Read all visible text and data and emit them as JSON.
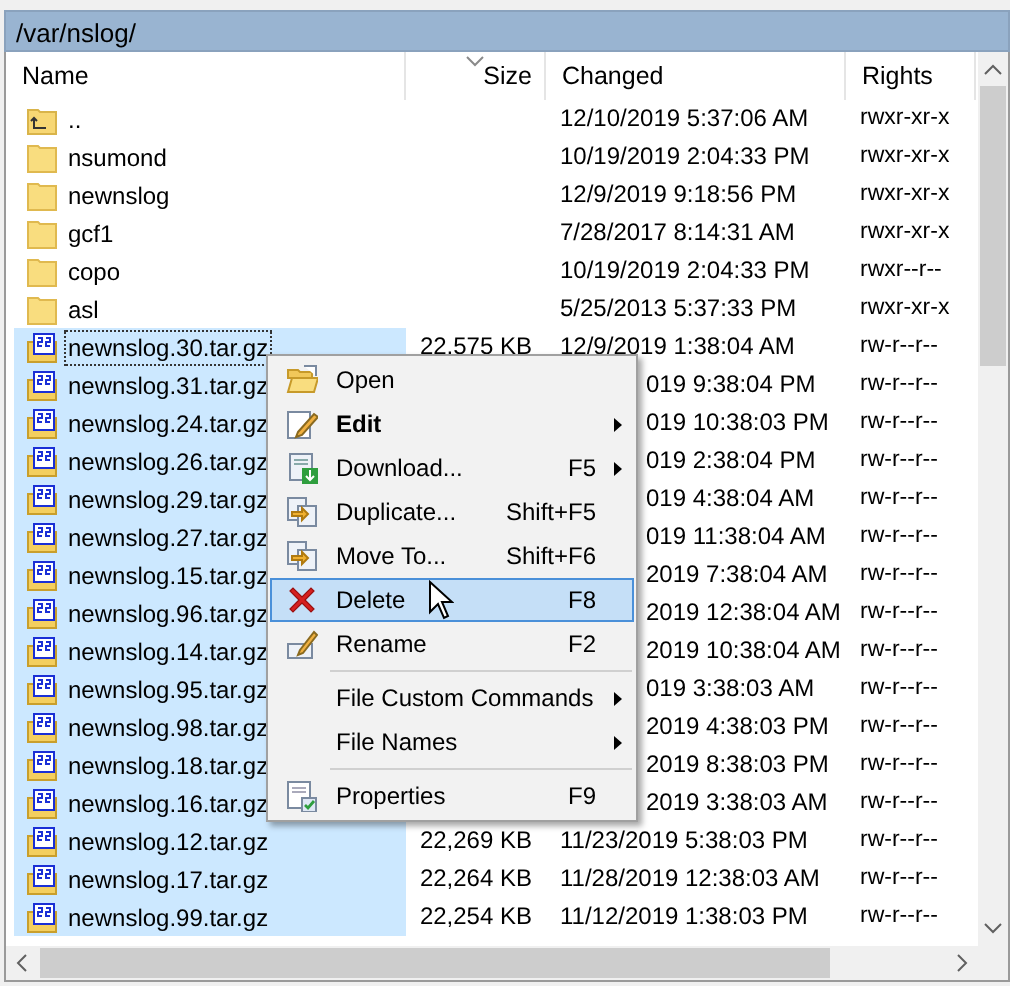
{
  "panel": {
    "path": "/var/nslog/"
  },
  "columns": [
    {
      "label": "Name",
      "sorted": false
    },
    {
      "label": "Size",
      "sorted": true
    },
    {
      "label": "Changed",
      "sorted": false
    },
    {
      "label": "Rights",
      "sorted": false
    }
  ],
  "rows": [
    {
      "kind": "parent",
      "name": "..",
      "changed": "12/10/2019 5:37:06 AM",
      "rights": "rwxr-xr-x",
      "selected": false,
      "focused": false
    },
    {
      "kind": "folder",
      "name": "nsumond",
      "changed": "10/19/2019 2:04:33 PM",
      "rights": "rwxr-xr-x",
      "selected": false,
      "focused": false
    },
    {
      "kind": "folder",
      "name": "newnslog",
      "changed": "12/9/2019 9:18:56 PM",
      "rights": "rwxr-xr-x",
      "selected": false,
      "focused": false
    },
    {
      "kind": "folder",
      "name": "gcf1",
      "changed": "7/28/2017 8:14:31 AM",
      "rights": "rwxr-xr-x",
      "selected": false,
      "focused": false
    },
    {
      "kind": "folder",
      "name": "copo",
      "changed": "10/19/2019 2:04:33 PM",
      "rights": "rwxr--r--",
      "selected": false,
      "focused": false
    },
    {
      "kind": "folder",
      "name": "asl",
      "changed": "5/25/2013 5:37:33 PM",
      "rights": "rwxr-xr-x",
      "selected": false,
      "focused": false
    },
    {
      "kind": "archive",
      "name": "newnslog.30.tar.gz",
      "size": "22,575 KB",
      "changed": "12/9/2019 1:38:04 AM",
      "rights": "rw-r--r--",
      "selected": true,
      "focused": true
    },
    {
      "kind": "archive",
      "name": "newnslog.31.tar.gz",
      "changed": "019 9:38:04 PM",
      "rights": "rw-r--r--",
      "selected": true,
      "focused": false
    },
    {
      "kind": "archive",
      "name": "newnslog.24.tar.gz",
      "changed": "019 10:38:03 PM",
      "rights": "rw-r--r--",
      "selected": true,
      "focused": false
    },
    {
      "kind": "archive",
      "name": "newnslog.26.tar.gz",
      "changed": "019 2:38:04 PM",
      "rights": "rw-r--r--",
      "selected": true,
      "focused": false
    },
    {
      "kind": "archive",
      "name": "newnslog.29.tar.gz",
      "changed": "019 4:38:04 AM",
      "rights": "rw-r--r--",
      "selected": true,
      "focused": false
    },
    {
      "kind": "archive",
      "name": "newnslog.27.tar.gz",
      "changed": "019 11:38:04 AM",
      "rights": "rw-r--r--",
      "selected": true,
      "focused": false
    },
    {
      "kind": "archive",
      "name": "newnslog.15.tar.gz",
      "changed": "2019 7:38:04 AM",
      "rights": "rw-r--r--",
      "selected": true,
      "focused": false
    },
    {
      "kind": "archive",
      "name": "newnslog.96.tar.gz",
      "changed": "2019 12:38:04 AM",
      "rights": "rw-r--r--",
      "selected": true,
      "focused": false
    },
    {
      "kind": "archive",
      "name": "newnslog.14.tar.gz",
      "changed": "2019 10:38:04 AM",
      "rights": "rw-r--r--",
      "selected": true,
      "focused": false
    },
    {
      "kind": "archive",
      "name": "newnslog.95.tar.gz",
      "changed": "019 3:38:03 AM",
      "rights": "rw-r--r--",
      "selected": true,
      "focused": false
    },
    {
      "kind": "archive",
      "name": "newnslog.98.tar.gz",
      "changed": "2019 4:38:03 PM",
      "rights": "rw-r--r--",
      "selected": true,
      "focused": false
    },
    {
      "kind": "archive",
      "name": "newnslog.18.tar.gz",
      "changed": "2019 8:38:03 PM",
      "rights": "rw-r--r--",
      "selected": true,
      "focused": false
    },
    {
      "kind": "archive",
      "name": "newnslog.16.tar.gz",
      "changed": "2019 3:38:03 AM",
      "rights": "rw-r--r--",
      "selected": true,
      "focused": false
    },
    {
      "kind": "archive",
      "name": "newnslog.12.tar.gz",
      "size": "22,269 KB",
      "changed": "11/23/2019 5:38:03 PM",
      "rights": "rw-r--r--",
      "selected": true,
      "focused": false
    },
    {
      "kind": "archive",
      "name": "newnslog.17.tar.gz",
      "size": "22,264 KB",
      "changed": "11/28/2019 12:38:03 AM",
      "rights": "rw-r--r--",
      "selected": true,
      "focused": false
    },
    {
      "kind": "archive",
      "name": "newnslog.99.tar.gz",
      "size": "22,254 KB",
      "changed": "11/12/2019 1:38:03 PM",
      "rights": "rw-r--r--",
      "selected": true,
      "focused": false
    }
  ],
  "context_menu": {
    "items": [
      {
        "kind": "item",
        "label": "Open",
        "default": false,
        "submenu": false,
        "selected": false
      },
      {
        "kind": "item",
        "label": "Edit",
        "default": true,
        "submenu": true,
        "selected": false
      },
      {
        "kind": "item",
        "label": "Download...",
        "shortcut": "F5",
        "default": false,
        "submenu": true,
        "selected": false
      },
      {
        "kind": "item",
        "label": "Duplicate...",
        "shortcut": "Shift+F5",
        "default": false,
        "submenu": false,
        "selected": false
      },
      {
        "kind": "item",
        "label": "Move To...",
        "shortcut": "Shift+F6",
        "default": false,
        "submenu": false,
        "selected": false
      },
      {
        "kind": "item",
        "label": "Delete",
        "shortcut": "F8",
        "default": false,
        "submenu": false,
        "selected": true
      },
      {
        "kind": "item",
        "label": "Rename",
        "shortcut": "F2",
        "default": false,
        "submenu": false,
        "selected": false
      },
      {
        "kind": "separator"
      },
      {
        "kind": "item",
        "label": "File Custom Commands",
        "default": false,
        "submenu": true,
        "selected": false
      },
      {
        "kind": "item",
        "label": "File Names",
        "default": false,
        "submenu": true,
        "selected": false
      },
      {
        "kind": "separator"
      },
      {
        "kind": "item",
        "label": "Properties",
        "shortcut": "F9",
        "default": false,
        "submenu": false,
        "selected": false
      }
    ]
  }
}
